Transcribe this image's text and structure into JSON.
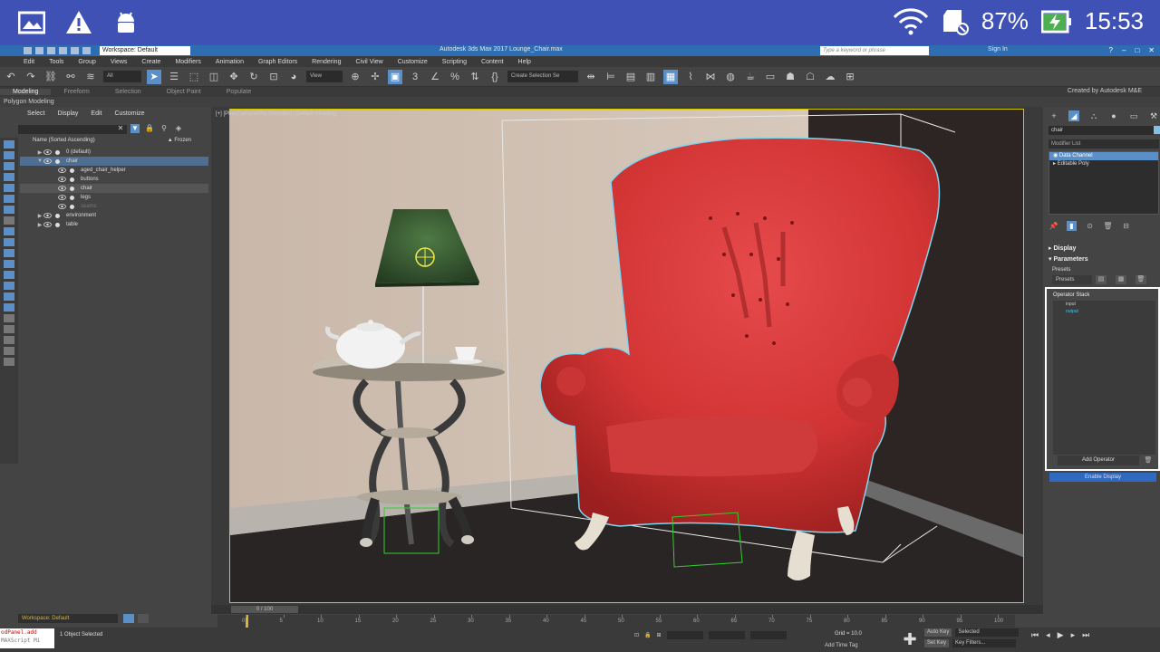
{
  "android_status": {
    "battery_percent": "87%",
    "time": "15:53"
  },
  "titlebar": {
    "workspace": "Workspace: Default",
    "app_title": "Autodesk 3ds Max 2017    Lounge_Chair.max",
    "search_placeholder": "Type a keyword or phrase",
    "signin": "Sign In"
  },
  "menubar": [
    "Edit",
    "Tools",
    "Group",
    "Views",
    "Create",
    "Modifiers",
    "Animation",
    "Graph Editors",
    "Rendering",
    "Civil View",
    "Customize",
    "Scripting",
    "Content",
    "Help"
  ],
  "toolbar": {
    "selection_filter": "All",
    "ref_coord": "View",
    "named_selection": "Create Selection Se"
  },
  "ribbon": {
    "tabs": [
      "Modeling",
      "Freeform",
      "Selection",
      "Object Paint",
      "Populate"
    ],
    "active_tab": "Modeling",
    "sub_label": "Polygon Modeling",
    "credit": "Created by Autodesk M&E"
  },
  "scene_explorer": {
    "menu": [
      "Select",
      "Display",
      "Edit",
      "Customize"
    ],
    "col_name": "Name (Sorted Ascending)",
    "col_frozen": "▲ Frozen",
    "items": [
      {
        "label": "0 (default)",
        "indent": 0,
        "twisty": "▶",
        "state": ""
      },
      {
        "label": "chair",
        "indent": 0,
        "twisty": "▼",
        "state": "sel"
      },
      {
        "label": "aged_chair_helper",
        "indent": 2,
        "twisty": "",
        "state": ""
      },
      {
        "label": "buttons",
        "indent": 2,
        "twisty": "",
        "state": ""
      },
      {
        "label": "chair",
        "indent": 2,
        "twisty": "",
        "state": "sel2"
      },
      {
        "label": "legs",
        "indent": 2,
        "twisty": "",
        "state": ""
      },
      {
        "label": "seams",
        "indent": 2,
        "twisty": "",
        "state": "dim"
      },
      {
        "label": "environment",
        "indent": 0,
        "twisty": "▶",
        "state": ""
      },
      {
        "label": "table",
        "indent": 0,
        "twisty": "▶",
        "state": ""
      }
    ]
  },
  "viewport": {
    "label": "[+] [PhysCamera001] [Standard] [Default Shading]"
  },
  "command_panel": {
    "object_name": "chair",
    "modifier_list": "Modifier List",
    "stack": [
      {
        "label": "Data Channel",
        "selected": true
      },
      {
        "label": "Editable Poly",
        "selected": false
      }
    ],
    "rollout_display": "Display",
    "rollout_params": "Parameters",
    "presets_label": "Presets",
    "presets_btn": "Presets",
    "operator_stack_title": "Operator Stack",
    "operators": [
      {
        "label": "input",
        "type": "in"
      },
      {
        "label": "output",
        "type": "out"
      }
    ],
    "add_operator": "Add Operator",
    "enable_display": "Enable Display"
  },
  "timeline": {
    "slider_label": "0 / 100",
    "frames": [
      "0",
      "5",
      "10",
      "15",
      "20",
      "25",
      "30",
      "35",
      "40",
      "45",
      "50",
      "55",
      "60",
      "65",
      "70",
      "75",
      "80",
      "85",
      "90",
      "95",
      "100"
    ]
  },
  "status": {
    "workspace": "Workspace: Default",
    "maxscript_line1": "odPanel.add",
    "maxscript_line2": "MAXScript Mi",
    "message": "1 Object Selected",
    "grid": "Grid = 10.0",
    "add_time_tag": "Add Time Tag",
    "auto_key": "Auto Key",
    "set_key": "Set Key",
    "key_mode": "Selected",
    "key_filters": "Key Filters..."
  }
}
